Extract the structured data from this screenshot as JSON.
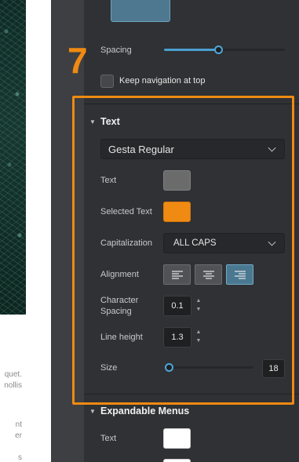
{
  "step_number": "7",
  "preview": {
    "text_lines": [
      "quet.",
      "nollis",
      "nt",
      "er",
      "s"
    ]
  },
  "nav_settings": {
    "spacing_label": "Spacing",
    "spacing_value": 0.45,
    "keep_nav_label": "Keep navigation at top",
    "keep_nav_checked": false
  },
  "text_section": {
    "title": "Text",
    "font": "Gesta Regular",
    "text_color_label": "Text",
    "text_color": "#6b6b6b",
    "selected_text_label": "Selected Text",
    "selected_text_color": "#ef8a12",
    "capitalization_label": "Capitalization",
    "capitalization_value": "ALL CAPS",
    "alignment_label": "Alignment",
    "alignment_options": [
      "left",
      "center",
      "right"
    ],
    "alignment_selected": "right",
    "character_spacing_label_1": "Character",
    "character_spacing_label_2": "Spacing",
    "character_spacing_value": "0.1",
    "line_height_label": "Line height",
    "line_height_value": "1.3",
    "size_label": "Size",
    "size_value": "18",
    "size_slider_fraction": 0.03
  },
  "expandable_section": {
    "title": "Expandable Menus",
    "text_label": "Text",
    "text_color": "#ffffff"
  },
  "colors": {
    "accent_orange": "#ef8a12",
    "panel_bg": "#2f3134",
    "active_blue": "#4a7891"
  }
}
